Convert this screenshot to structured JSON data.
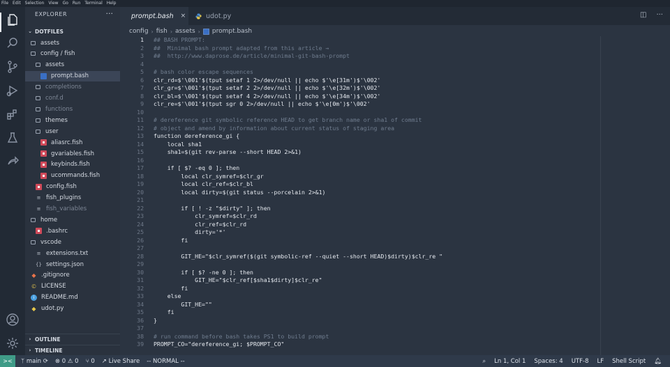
{
  "menu": [
    "File",
    "Edit",
    "Selection",
    "View",
    "Go",
    "Run",
    "Terminal",
    "Help"
  ],
  "explorer": {
    "title": "EXPLORER",
    "more": "···",
    "root": "DOTFILES",
    "tree": [
      {
        "label": "assets",
        "type": "folder",
        "depth": 1
      },
      {
        "label": "config / fish",
        "type": "folder",
        "depth": 1
      },
      {
        "label": "assets",
        "type": "folder",
        "depth": 2
      },
      {
        "label": "prompt.bash",
        "type": "bash",
        "depth": 3,
        "selected": true
      },
      {
        "label": "completions",
        "type": "folder",
        "depth": 2,
        "dim": true
      },
      {
        "label": "conf.d",
        "type": "folder",
        "depth": 2,
        "dim": true
      },
      {
        "label": "functions",
        "type": "folder",
        "depth": 2,
        "dim": true
      },
      {
        "label": "themes",
        "type": "folder",
        "depth": 2
      },
      {
        "label": "user",
        "type": "folder",
        "depth": 2
      },
      {
        "label": "aliasrc.fish",
        "type": "fish",
        "depth": 3
      },
      {
        "label": "gvariables.fish",
        "type": "fish",
        "depth": 3
      },
      {
        "label": "keybinds.fish",
        "type": "fish",
        "depth": 3
      },
      {
        "label": "ucommands.fish",
        "type": "fish",
        "depth": 3
      },
      {
        "label": "config.fish",
        "type": "fish",
        "depth": 2
      },
      {
        "label": "fish_plugins",
        "type": "txt",
        "depth": 2
      },
      {
        "label": "fish_variables",
        "type": "txt",
        "depth": 2,
        "dim": true
      },
      {
        "label": "home",
        "type": "folder",
        "depth": 1
      },
      {
        "label": ".bashrc",
        "type": "fish",
        "depth": 2
      },
      {
        "label": "vscode",
        "type": "folder",
        "depth": 1
      },
      {
        "label": "extensions.txt",
        "type": "txt",
        "depth": 2
      },
      {
        "label": "settings.json",
        "type": "json",
        "depth": 2
      },
      {
        "label": ".gitignore",
        "type": "git",
        "depth": 1
      },
      {
        "label": "LICENSE",
        "type": "lic",
        "depth": 1
      },
      {
        "label": "README.md",
        "type": "info",
        "depth": 1
      },
      {
        "label": "udot.py",
        "type": "py",
        "depth": 1
      }
    ],
    "outline": "OUTLINE",
    "timeline": "TIMELINE"
  },
  "tabs": [
    {
      "label": "prompt.bash",
      "active": true,
      "icon": "bash-file-icon"
    },
    {
      "label": "udot.py",
      "active": false,
      "icon": "python-file-icon"
    }
  ],
  "tab_close": "×",
  "breadcrumb": [
    "config",
    "fish",
    "assets",
    "prompt.bash"
  ],
  "editor": {
    "first_line": 1,
    "current_line": 1,
    "lines": [
      {
        "t": "## BASH PROMPT:",
        "c": true
      },
      {
        "t": "##  Minimal bash prompt adapted from this article →",
        "c": true
      },
      {
        "t": "##  http://www.daprose.de/article/minimal-git-bash-prompt",
        "c": true
      },
      {
        "t": "",
        "c": false
      },
      {
        "t": "# bash color escape sequences",
        "c": true
      },
      {
        "t": "clr_rd=$'\\001'$(tput setaf 1 2>/dev/null || echo $'\\e[31m')$'\\002'",
        "c": false
      },
      {
        "t": "clr_gr=$'\\001'$(tput setaf 2 2>/dev/null || echo $'\\e[32m')$'\\002'",
        "c": false
      },
      {
        "t": "clr_bl=$'\\001'$(tput setaf 4 2>/dev/null || echo $'\\e[34m')$'\\002'",
        "c": false
      },
      {
        "t": "clr_re=$'\\001'$(tput sgr 0 2>/dev/null || echo $'\\e[0m')$'\\002'",
        "c": false
      },
      {
        "t": "",
        "c": false
      },
      {
        "t": "# dereference git symbolic reference HEAD to get branch name or sha1 of commit",
        "c": true
      },
      {
        "t": "# object and amend by information about current status of staging area",
        "c": true
      },
      {
        "t": "function dereference_gi {",
        "c": false
      },
      {
        "t": "    local sha1",
        "c": false
      },
      {
        "t": "    sha1=$(git rev-parse --short HEAD 2>&1)",
        "c": false
      },
      {
        "t": "",
        "c": false
      },
      {
        "t": "    if [ $? -eq 0 ]; then",
        "c": false
      },
      {
        "t": "        local clr_symref=$clr_gr",
        "c": false
      },
      {
        "t": "        local clr_ref=$clr_bl",
        "c": false
      },
      {
        "t": "        local dirty=$(git status --porcelain 2>&1)",
        "c": false
      },
      {
        "t": "",
        "c": false
      },
      {
        "t": "        if [ ! -z \"$dirty\" ]; then",
        "c": false
      },
      {
        "t": "            clr_symref=$clr_rd",
        "c": false
      },
      {
        "t": "            clr_ref=$clr_rd",
        "c": false
      },
      {
        "t": "            dirty='*'",
        "c": false
      },
      {
        "t": "        fi",
        "c": false
      },
      {
        "t": "",
        "c": false
      },
      {
        "t": "        GIT_HE=\"$clr_symref($(git symbolic-ref --quiet --short HEAD)$dirty)$clr_re \"",
        "c": false
      },
      {
        "t": "",
        "c": false
      },
      {
        "t": "        if [ $? -ne 0 ]; then",
        "c": false
      },
      {
        "t": "            GIT_HE=\"$clr_ref[$sha1$dirty]$clr_re\"",
        "c": false
      },
      {
        "t": "        fi",
        "c": false
      },
      {
        "t": "    else",
        "c": false
      },
      {
        "t": "        GIT_HE=\"\"",
        "c": false
      },
      {
        "t": "    fi",
        "c": false
      },
      {
        "t": "}",
        "c": false
      },
      {
        "t": "",
        "c": false
      },
      {
        "t": "# run command before bash takes PS1 to build prompt",
        "c": true
      },
      {
        "t": "PROMPT_CO=\"dereference_gi; $PROMPT_CO\"",
        "c": false
      }
    ]
  },
  "status": {
    "remote": "><",
    "branch": "main",
    "sync": "⟳",
    "errors": "⊗ 0",
    "warnings": "⚠ 0",
    "ports": "⑂ 0",
    "liveshare": "Live Share",
    "mode": "-- NORMAL --",
    "position": "Ln 1, Col 1",
    "spaces": "Spaces: 4",
    "encoding": "UTF-8",
    "eol": "LF",
    "language": "Shell Script"
  }
}
